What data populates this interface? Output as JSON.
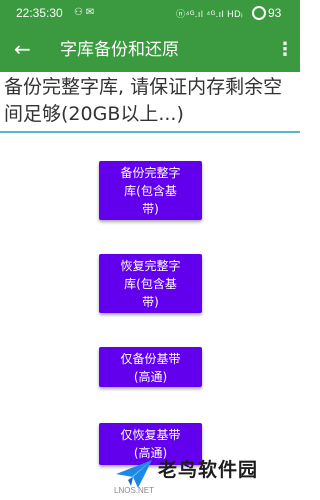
{
  "status_bar": {
    "time": "22:35:30",
    "notification_icons": "⚇ ✉",
    "network_text": "ⓝ⁴ᴳ.ıl ⁴ᴳ.ıl HDᵢ",
    "battery_level": "93"
  },
  "app_bar": {
    "title": "字库备份和还原",
    "back_icon": "arrow-back-icon",
    "more_icon": "more-vert-icon"
  },
  "notice": {
    "text": "备份完整字库, 请保证内存剩余空间足够(20GB以上...)"
  },
  "buttons": {
    "backup_full": "备份完整字\n库(包含基\n带)",
    "restore_full": "恢复完整字\n库(包含基\n带)",
    "backup_baseband": "仅备份基带\n(高通)",
    "restore_baseband": "仅恢复基带\n(高通)"
  },
  "watermark": {
    "name": "老鸟软件园",
    "url": "LNOS.NET"
  },
  "colors": {
    "app_bar": "#3b9a3f",
    "button": "#6200ee",
    "divider": "#57b7c9"
  }
}
